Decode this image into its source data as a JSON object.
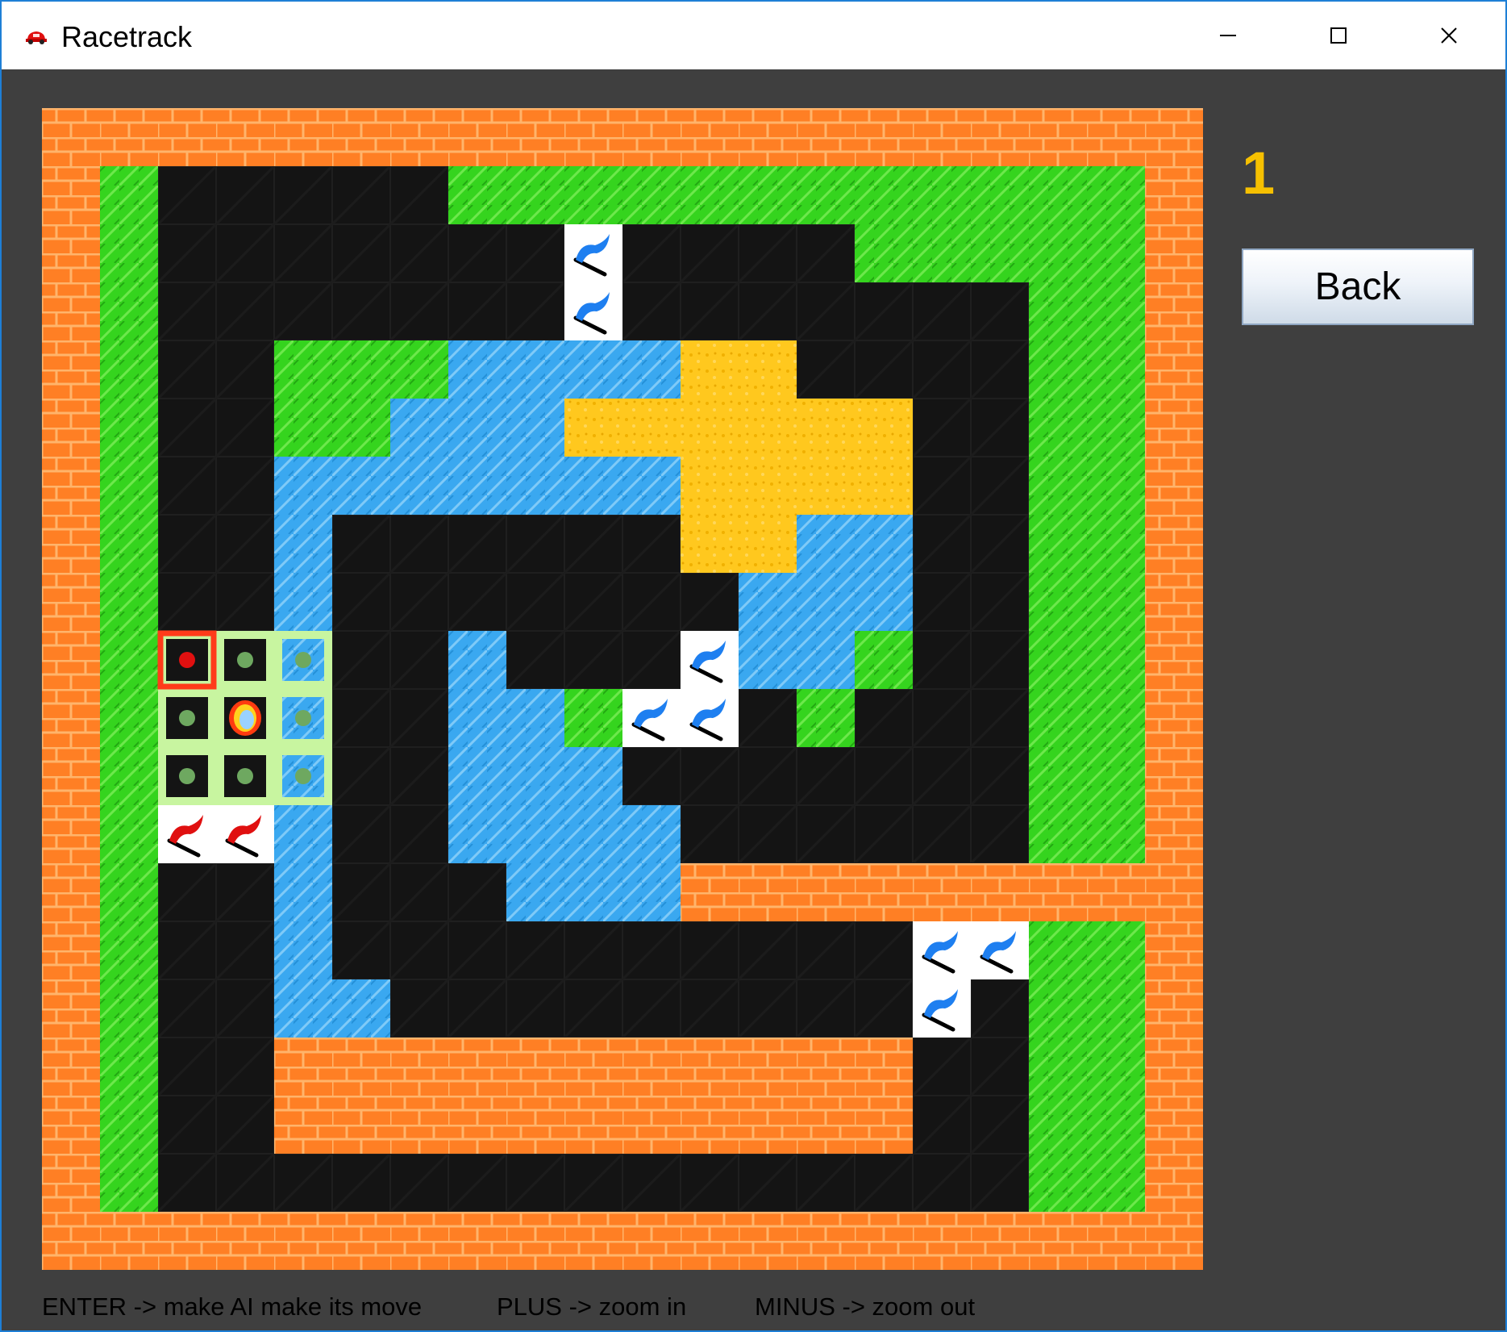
{
  "window": {
    "title": "Racetrack",
    "app_icon": "red-car-icon",
    "controls": [
      "minimize-icon",
      "maximize-icon",
      "close-icon"
    ]
  },
  "sidebar": {
    "score": "1",
    "back_label": "Back"
  },
  "help": {
    "enter": "ENTER -> make AI make its move",
    "plus": "PLUS -> zoom in",
    "minus": "MINUS -> zoom out"
  },
  "board": {
    "columns": 20,
    "rows": 20,
    "legend": {
      "W": "wall",
      "G": "grass",
      "R": "road",
      "A": "water",
      "S": "sand",
      "B": "checkpoint-flag-blue",
      "F": "start-flag-red",
      "P": "player-car",
      "M": "possible-move"
    },
    "grid": [
      "WWWWWWWWWWWWWWWWWWWW",
      "WGRRRRRGGGGGGGGGGGGW",
      "WGRRRRRRRBRRRRGGGGGW",
      "WGRRRRRRRBRRRRRRRGGW",
      "WGRRGGGAAAASSRRRRGGW",
      "WGRRGGAAASSSSSSRRGGW",
      "WGRRAAAAAAASSSSRRGGW",
      "WGRRARRRRRRSSAARRGGW",
      "WGRRARRRRRRRAAARRGGW",
      "WGMMMRRARRRBAAGRRGGW",
      "WGMPMRRAAGBBRGRRRGGW",
      "WGMMMRRAAARRRRRRRGGW",
      "WGFFARRAAAARRRRRRGGW",
      "WGRRARRRAAAWWWWWWWWW",
      "WGRRARRRRRRRRRRBBGGW",
      "WGRRAARRRRRRRRRBRGGW",
      "WGRRWWWWWWWWWWWRRGGW",
      "WGRRWWWWWWWWWWWRRGGW",
      "WGRRRRRRRRRRRRRRRGGW",
      "WWWWWWWWWWWWWWWWWWWW"
    ],
    "move_options": [
      {
        "cell": "9,2",
        "selected": true
      },
      {
        "cell": "9,3",
        "selected": false
      },
      {
        "cell": "9,4",
        "selected": false
      },
      {
        "cell": "10,2",
        "selected": false
      },
      {
        "cell": "10,4",
        "selected": false
      },
      {
        "cell": "11,2",
        "selected": false
      },
      {
        "cell": "11,3",
        "selected": false
      },
      {
        "cell": "11,4",
        "selected": false
      }
    ],
    "colors": {
      "wall": "#ff7f24",
      "wall_mortar": "#ffb46b",
      "grass": "#35d41e",
      "road": "#141414",
      "water": "#3aa8f0",
      "sand": "#ffc81e",
      "flag_bg": "#ffffff",
      "blue_flag": "#1e7ff0",
      "red_flag": "#e01010",
      "move_overlay": "#c8f5a0",
      "selected_move": "#ff3b1a",
      "score": "#f6c000"
    }
  }
}
